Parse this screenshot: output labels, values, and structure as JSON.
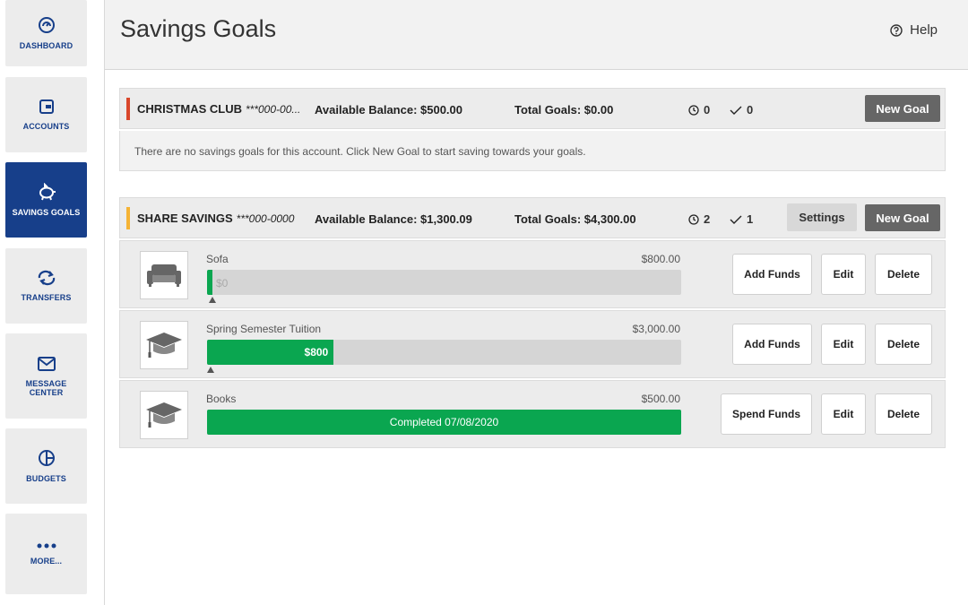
{
  "sidebar": {
    "items": [
      {
        "label": "DASHBOARD",
        "icon": "gauge-icon"
      },
      {
        "label": "ACCOUNTS",
        "icon": "wallet-icon"
      },
      {
        "label": "SAVINGS GOALS",
        "icon": "piggy-bank-icon",
        "active": true
      },
      {
        "label": "TRANSFERS",
        "icon": "transfer-arrows-icon"
      },
      {
        "label": "MESSAGE CENTER",
        "icon": "envelope-icon"
      },
      {
        "label": "BUDGETS",
        "icon": "pie-chart-icon"
      },
      {
        "label": "MORE...",
        "icon": "more-dots-icon"
      }
    ]
  },
  "header": {
    "title": "Savings Goals",
    "help_label": "Help"
  },
  "accounts": [
    {
      "name": "CHRISTMAS CLUB",
      "number": "***000-00...",
      "available_balance": "Available Balance: $500.00",
      "total_goals": "Total Goals: $0.00",
      "pending_count": "0",
      "completed_count": "0",
      "accent_color": "#d9472b",
      "new_goal_label": "New Goal",
      "empty_message": "There are no savings goals for this account. Click New Goal to start saving towards your goals."
    },
    {
      "name": "SHARE SAVINGS",
      "number": "***000-0000",
      "available_balance": "Available Balance: $1,300.09",
      "total_goals": "Total Goals: $4,300.00",
      "pending_count": "2",
      "completed_count": "1",
      "accent_color": "#f5b335",
      "settings_label": "Settings",
      "new_goal_label": "New Goal",
      "goals": [
        {
          "name": "Sofa",
          "target": "$800.00",
          "saved": "$0",
          "progress": 0,
          "icon": "sofa-icon",
          "primary_action": "Add Funds",
          "edit_label": "Edit",
          "delete_label": "Delete"
        },
        {
          "name": "Spring Semester Tuition",
          "target": "$3,000.00",
          "saved": "$800",
          "progress": 0.267,
          "icon": "graduation-cap-icon",
          "primary_action": "Add Funds",
          "edit_label": "Edit",
          "delete_label": "Delete"
        },
        {
          "name": "Books",
          "target": "$500.00",
          "status": "Completed 07/08/2020",
          "progress": 1,
          "icon": "graduation-cap-icon",
          "primary_action": "Spend Funds",
          "edit_label": "Edit",
          "delete_label": "Delete"
        }
      ]
    }
  ],
  "colors": {
    "brand_blue": "#173f8a",
    "progress_green": "#0aa650",
    "dark_button": "#666666"
  }
}
